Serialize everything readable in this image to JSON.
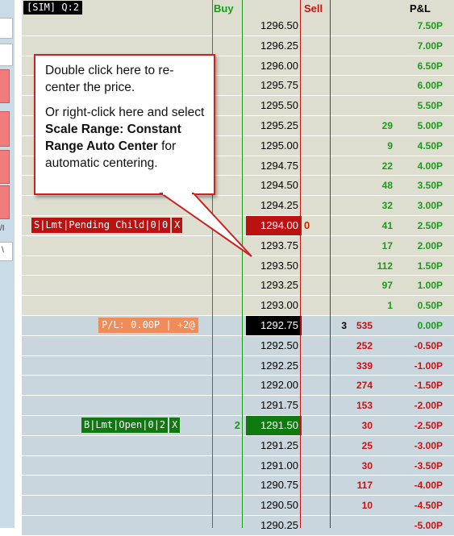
{
  "header": {
    "account": "[SIM]  Q:2",
    "buy": "Buy",
    "sell": "Sell",
    "pnl": "P&L"
  },
  "callout": {
    "line1": "Double click here to re-center the price.",
    "line2_pre": "Or right-click here and select ",
    "line2_bold": "Scale Range: Constant Range Auto Center",
    "line2_post": " for automatic centering."
  },
  "left_strip": {
    "glyph1": "/I",
    "glyph2": "\\"
  },
  "rows": [
    {
      "price": "1296.50",
      "pnl": "7.50P",
      "side": "above"
    },
    {
      "price": "1296.25",
      "pnl": "7.00P",
      "side": "above"
    },
    {
      "price": "1296.00",
      "pnl": "6.50P",
      "side": "above"
    },
    {
      "price": "1295.75",
      "pnl": "6.00P",
      "side": "above"
    },
    {
      "price": "1295.50",
      "pnl": "5.50P",
      "side": "above"
    },
    {
      "price": "1295.25",
      "bid": "29",
      "pnl": "5.00P",
      "side": "above"
    },
    {
      "price": "1295.00",
      "bid": "9",
      "pnl": "4.50P",
      "side": "above"
    },
    {
      "price": "1294.75",
      "bid": "22",
      "pnl": "4.00P",
      "side": "above"
    },
    {
      "price": "1294.50",
      "bid": "48",
      "pnl": "3.50P",
      "side": "above"
    },
    {
      "price": "1294.25",
      "bid": "32",
      "pnl": "3.00P",
      "side": "above"
    },
    {
      "price": "1294.00",
      "bid": "41",
      "pnl": "2.50P",
      "side": "above",
      "sellqty": "0",
      "hl": "red"
    },
    {
      "price": "1293.75",
      "bid": "17",
      "pnl": "2.00P",
      "side": "above"
    },
    {
      "price": "1293.50",
      "bid": "112",
      "pnl": "1.50P",
      "side": "above"
    },
    {
      "price": "1293.25",
      "bid": "97",
      "pnl": "1.00P",
      "side": "above"
    },
    {
      "price": "1293.00",
      "bid": "1",
      "pnl": "0.50P",
      "side": "above"
    },
    {
      "price": "1292.75",
      "last": "3",
      "ask": "535",
      "pnl": "0.00P",
      "side": "below",
      "hl": "black"
    },
    {
      "price": "1292.50",
      "ask": "252",
      "pnl": "-0.50P",
      "side": "below"
    },
    {
      "price": "1292.25",
      "ask": "339",
      "pnl": "-1.00P",
      "side": "below"
    },
    {
      "price": "1292.00",
      "ask": "274",
      "pnl": "-1.50P",
      "side": "below"
    },
    {
      "price": "1291.75",
      "ask": "153",
      "pnl": "-2.00P",
      "side": "below"
    },
    {
      "price": "1291.50",
      "ask": "30",
      "pnl": "-2.50P",
      "side": "below",
      "buyqty": "2",
      "hl": "green"
    },
    {
      "price": "1291.25",
      "ask": "25",
      "pnl": "-3.00P",
      "side": "below"
    },
    {
      "price": "1291.00",
      "ask": "30",
      "pnl": "-3.50P",
      "side": "below"
    },
    {
      "price": "1290.75",
      "ask": "117",
      "pnl": "-4.00P",
      "side": "below"
    },
    {
      "price": "1290.50",
      "ask": "10",
      "pnl": "-4.50P",
      "side": "below"
    },
    {
      "price": "1290.25",
      "pnl": "-5.00P",
      "side": "below"
    }
  ],
  "orders": {
    "sell_pending": [
      "S",
      "Lmt",
      "Pending Child",
      "0",
      "0",
      "X"
    ],
    "pl_status": "P/L: 0.00P | +2@",
    "buy_open": [
      "B",
      "Lmt",
      "Open",
      "0",
      "2",
      "X"
    ]
  },
  "colors": {
    "above_bg": "#deded0",
    "below_bg": "#c9d6de",
    "buy_green": "#1a9a1a",
    "sell_red": "#cc1111",
    "callout_border": "#cc2222"
  }
}
